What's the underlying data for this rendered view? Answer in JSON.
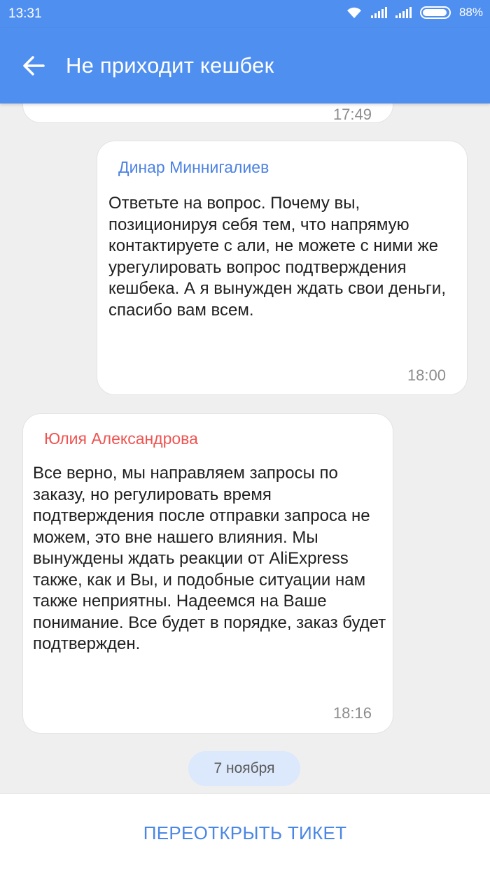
{
  "status_bar": {
    "time": "13:31",
    "battery": "88%"
  },
  "header": {
    "title": "Не приходит кешбек",
    "back_icon": "arrow-left-icon"
  },
  "messages": [
    {
      "author": "",
      "text": "",
      "time": "17:49"
    },
    {
      "author": "Динар Миннигалиев",
      "text": "Ответьте на вопрос. Почему вы, позиционируя себя тем, что напрямую контактируете с али, не можете с ними же урегулировать вопрос подтверждения кешбека. А я вынужден ждать свои деньги, спасибо вам всем.",
      "time": "18:00"
    },
    {
      "author": "Юлия Александрова",
      "text": "Все верно, мы направляем запросы по заказу, но регулировать время подтверждения после отправки запроса не можем, это вне нашего влияния. Мы вынуждены ждать реакции от AliExpress также, как и Вы, и подобные ситуации нам также неприятны. Надеемся на Ваше понимание. Все будет в порядке, заказ будет подтвержден.",
      "time": "18:16"
    }
  ],
  "date_chip": "7 ноября",
  "footer": {
    "reopen_label": "ПЕРЕОТКРЫТЬ ТИКЕТ"
  },
  "colors": {
    "primary": "#4f8ff0",
    "agent_name": "#ef5350",
    "user_name": "#4c82e3"
  }
}
